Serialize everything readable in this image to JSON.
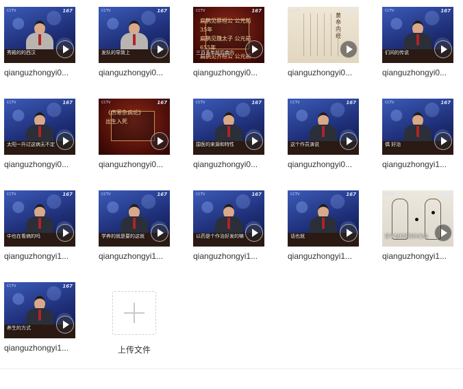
{
  "files": [
    {
      "name": "qianguzhongyi0...",
      "caption": "秀殿的的西汉",
      "style": "speaker-light"
    },
    {
      "name": "qianguzhongyi0...",
      "caption": "发队的导致上",
      "style": "speaker-light"
    },
    {
      "name": "qianguzhongyi0...",
      "caption": "三百多年前后南内",
      "style": "red",
      "lines": [
        "扁鹊见蔡桓公 公元前35年",
        "扁鹊见魏太子 公元前655年",
        "扁鹊见齐桓公 公元前309"
      ]
    },
    {
      "name": "qianguzhongyi0...",
      "caption": "",
      "style": "paper",
      "lines": [
        "黄帝内经"
      ]
    },
    {
      "name": "qianguzhongyi0...",
      "caption": "们间的传说",
      "style": "speaker"
    },
    {
      "name": "qianguzhongyi0...",
      "caption": "太阳一升过这病无不定",
      "style": "speaker"
    },
    {
      "name": "qianguzhongyi0...",
      "caption": "",
      "style": "red",
      "lines": [
        "《伤寒杂病论》",
        "出生入死"
      ]
    },
    {
      "name": "qianguzhongyi0...",
      "caption": "国医的来源和特性",
      "style": "speaker"
    },
    {
      "name": "qianguzhongyi0...",
      "caption": "这个作员演说",
      "style": "speaker"
    },
    {
      "name": "qianguzhongyi1...",
      "caption": "偶 好治",
      "style": "speaker"
    },
    {
      "name": "qianguzhongyi1...",
      "caption": "中也在看病的吗",
      "style": "speaker"
    },
    {
      "name": "qianguzhongyi1...",
      "caption": "学养的就是要的这就",
      "style": "speaker"
    },
    {
      "name": "qianguzhongyi1...",
      "caption": "以药是个作治好发的嘛",
      "style": "speaker"
    },
    {
      "name": "qianguzhongyi1...",
      "caption": "话也就",
      "style": "speaker"
    },
    {
      "name": "qianguzhongyi1...",
      "caption": "那于是和阴阳失衡会",
      "style": "sketch"
    },
    {
      "name": "qianguzhongyi1...",
      "caption": "养生的方式",
      "style": "speaker"
    }
  ],
  "logo_text": "167",
  "tv_label": "CCTV",
  "upload": {
    "label": "上传文件"
  }
}
